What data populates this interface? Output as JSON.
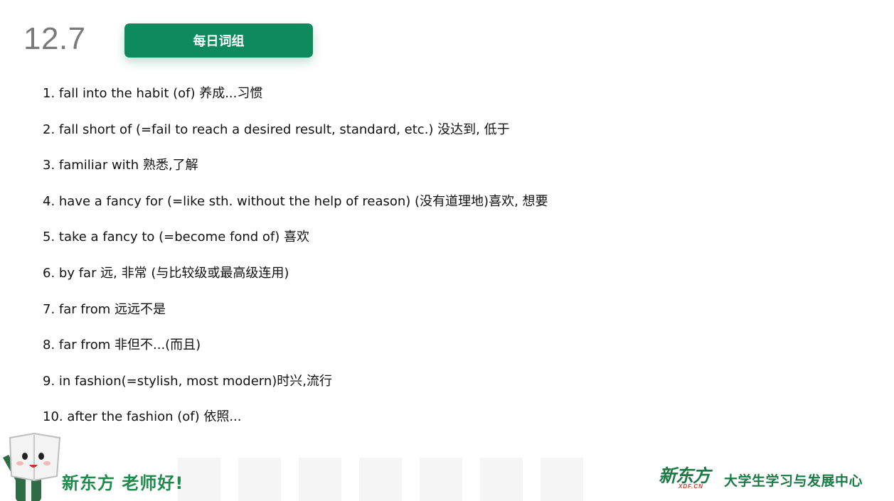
{
  "header": {
    "date": "12.7",
    "title": "每日词组"
  },
  "phrases": [
    "1. fall into the habit (of) 养成...习惯",
    "2. fall short of (=fail to reach a desired result, standard, etc.) 没达到, 低于",
    "3. familiar with 熟悉,了解",
    "4. have a fancy for (=like sth. without the help of reason) (没有道理地)喜欢, 想要",
    "5. take a fancy to (=become fond of) 喜欢",
    "6. by far 远, 非常 (与比较级或最高级连用)",
    "7. far from 远远不是",
    "8. far from 非但不...(而且)",
    "9. in fashion(=stylish, most modern)时兴,流行",
    "10. after the fashion (of) 依照..."
  ],
  "footer": {
    "slogan": "新东方 老师好!",
    "logo_cn": "新东方",
    "logo_en": "XDF.CN",
    "center_name": "大学生学习与发展中心"
  },
  "colors": {
    "brand_green": "#0f8a5f",
    "footer_green": "#1b7a45",
    "logo_red": "#d13a2a",
    "date_gray": "#7a7a7a"
  },
  "icons": {
    "mascot": "book-mascot-icon"
  }
}
